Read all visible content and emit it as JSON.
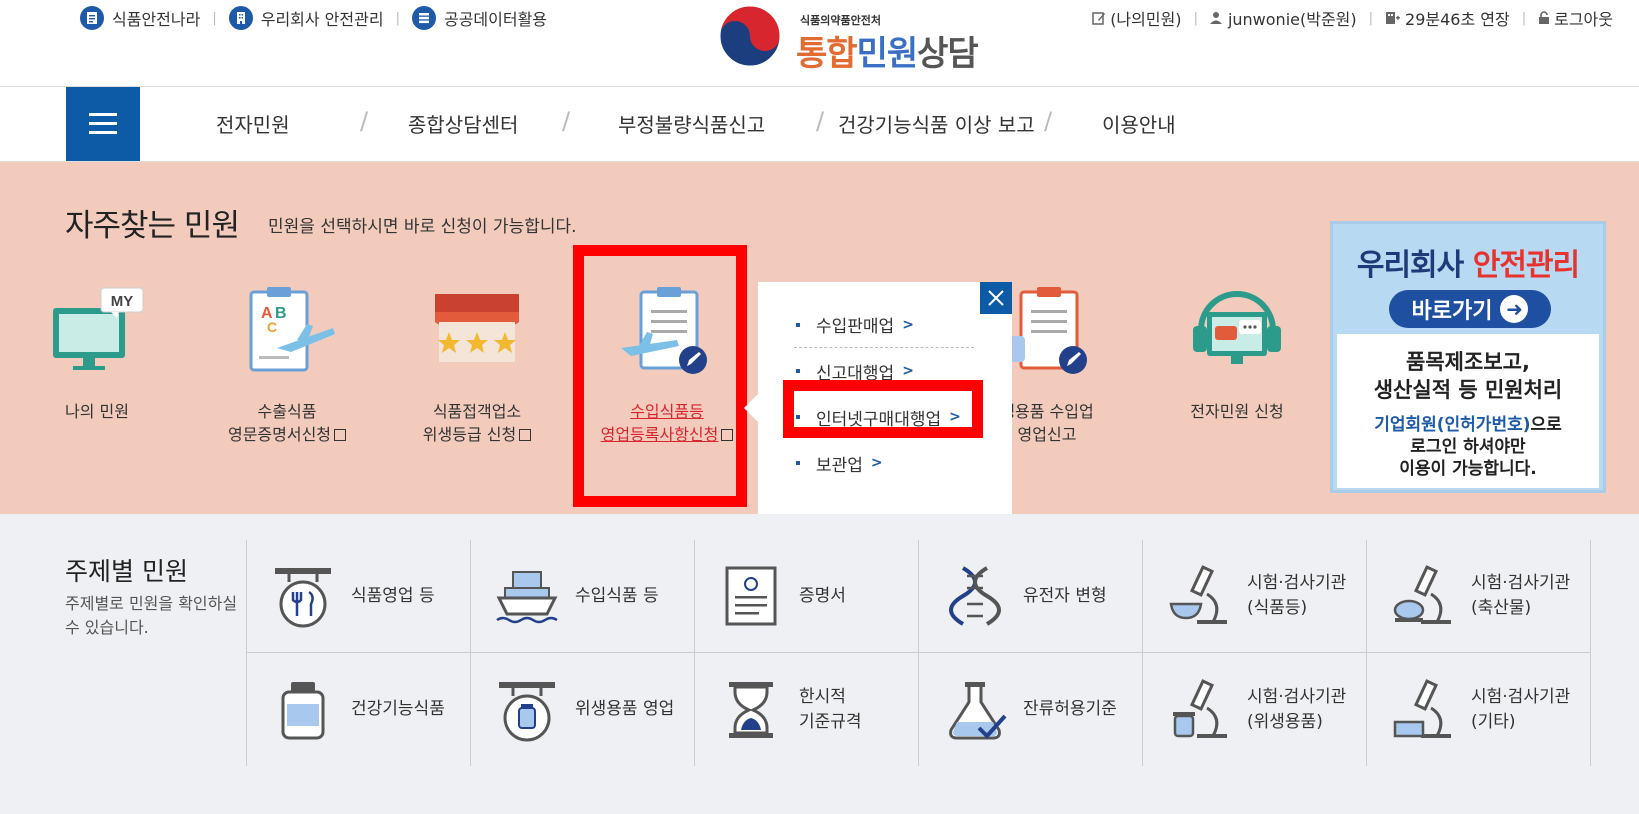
{
  "util_left": [
    {
      "label": "식품안전나라",
      "icon": "document-icon"
    },
    {
      "label": "우리회사 안전관리",
      "icon": "building-icon"
    },
    {
      "label": "공공데이터활용",
      "icon": "database-icon"
    }
  ],
  "logo": {
    "ministry": "식품의약품안전처",
    "brand_1": "통합",
    "brand_2": "민원",
    "brand_3": "상담"
  },
  "util_right": {
    "my_complaints": "(나의민원)",
    "user": "junwonie(박준원)",
    "timer": "29분46초 연장",
    "logout": "로그아웃"
  },
  "gnb": [
    "전자민원",
    "종합상담센터",
    "부정불량식품신고",
    "건강기능식품 이상 보고",
    "이용안내"
  ],
  "frequent": {
    "title": "자주찾는 민원",
    "subtitle": "민원을 선택하시면 바로 신청이 가능합니다.",
    "items": [
      {
        "line1": "나의 민원",
        "line2": ""
      },
      {
        "line1": "수출식품",
        "line2": "영문증명서신청"
      },
      {
        "line1": "식품접객업소",
        "line2": "위생등급 신청"
      },
      {
        "line1": "수입식품등",
        "line2": "영업등록사항신청"
      },
      {
        "line1": "생용품 수입업",
        "line2": "영업신고"
      },
      {
        "line1": "전자민원 신청",
        "line2": ""
      }
    ]
  },
  "popup": {
    "items": [
      "수입판매업",
      "신고대행업",
      "인터넷구매대행업",
      "보관업"
    ]
  },
  "banner": {
    "title_1": "우리회사 ",
    "title_2": "안전관리",
    "go": "바로가기",
    "line1": "품목제조보고,",
    "line2": "생산실적 등 민원처리",
    "line3_blue": "기업회원(인허가번호)",
    "line3_rest": "으로",
    "line4": "로그인 하셔야만",
    "line5": "이용이 가능합니다."
  },
  "theme": {
    "title": "주제별 민원",
    "subtitle": "주제별로 민원을 확인하실 수 있습니다.",
    "cells": [
      {
        "l1": "식품영업 등",
        "l2": ""
      },
      {
        "l1": "수입식품 등",
        "l2": ""
      },
      {
        "l1": "증명서",
        "l2": ""
      },
      {
        "l1": "유전자 변형",
        "l2": ""
      },
      {
        "l1": "시험·검사기관",
        "l2": "(식품등)"
      },
      {
        "l1": "시험·검사기관",
        "l2": "(축산물)"
      },
      {
        "l1": "건강기능식품",
        "l2": ""
      },
      {
        "l1": "위생용품 영업",
        "l2": ""
      },
      {
        "l1": "한시적",
        "l2": "기준규격"
      },
      {
        "l1": "잔류허용기준",
        "l2": ""
      },
      {
        "l1": "시험·검사기관",
        "l2": "(위생용품)"
      },
      {
        "l1": "시험·검사기관",
        "l2": "(기타)"
      }
    ]
  }
}
